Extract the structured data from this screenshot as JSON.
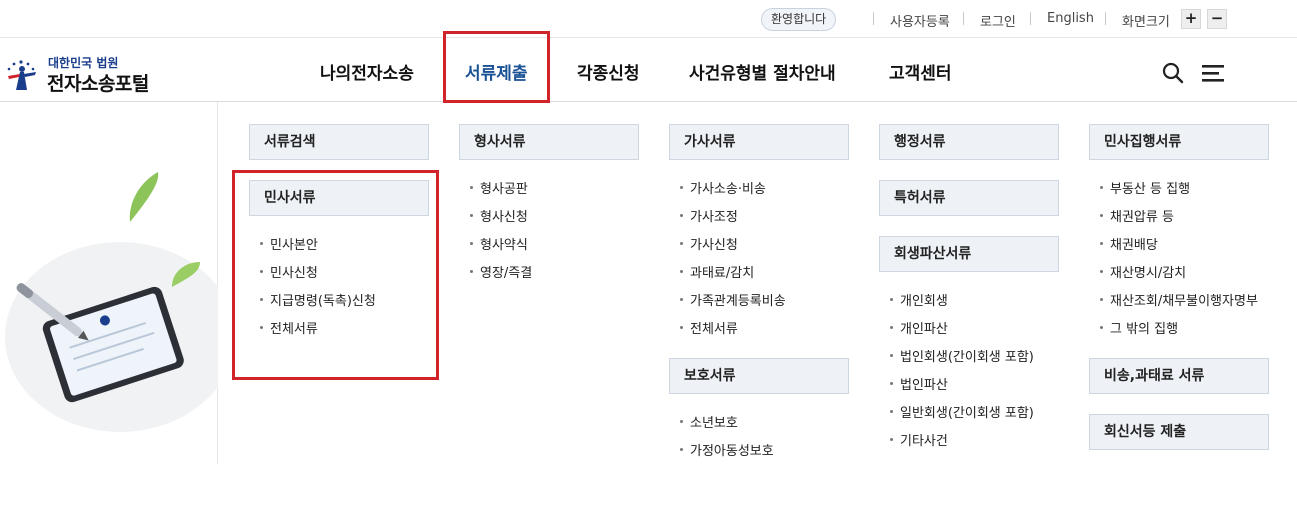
{
  "topbar": {
    "welcome": "환영합니다",
    "register": "사용자등록",
    "login": "로그인",
    "english": "English",
    "zoom_label": "화면크기",
    "zoom_in": "+",
    "zoom_out": "−"
  },
  "logo": {
    "small": "대한민국 법원",
    "big": "전자소송포털"
  },
  "gnb": [
    {
      "label": "나의전자소송"
    },
    {
      "label": "서류제출"
    },
    {
      "label": "각종신청"
    },
    {
      "label": "사건유형별 절차안내"
    },
    {
      "label": "고객센터"
    }
  ],
  "icons": {
    "search": "search-icon",
    "menu": "hamburger-menu-icon"
  },
  "colors": {
    "accent": "#1a5296",
    "highlight_box": "#d1232a",
    "category_bg": "#eef2f7"
  },
  "menu": {
    "col1": {
      "search_doc": "서류검색",
      "civil": "민사서류",
      "civil_items": [
        "민사본안",
        "민사신청",
        "지급명령(독촉)신청",
        "전체서류"
      ]
    },
    "col2": {
      "criminal": "형사서류",
      "criminal_items": [
        "형사공판",
        "형사신청",
        "형사약식",
        "영장/즉결"
      ]
    },
    "col3": {
      "family": "가사서류",
      "family_items": [
        "가사소송·비송",
        "가사조정",
        "가사신청",
        "과태료/감치",
        "가족관계등록비송",
        "전체서류"
      ],
      "protection": "보호서류",
      "protection_items": [
        "소년보호",
        "가정아동성보호"
      ]
    },
    "col4": {
      "admin": "행정서류",
      "patent": "특허서류",
      "rehab": "회생파산서류",
      "rehab_items": [
        "개인회생",
        "개인파산",
        "법인회생(간이회생 포함)",
        "법인파산",
        "일반회생(간이회생 포함)",
        "기타사건"
      ]
    },
    "col5": {
      "execution": "민사집행서류",
      "execution_items": [
        "부동산 등 집행",
        "채권압류 등",
        "채권배당",
        "재산명시/감치",
        "재산조회/채무불이행자명부",
        "그 밖의 집행"
      ],
      "noncontentious": "비송,과태료 서류",
      "reply": "회신서등 제출"
    }
  }
}
